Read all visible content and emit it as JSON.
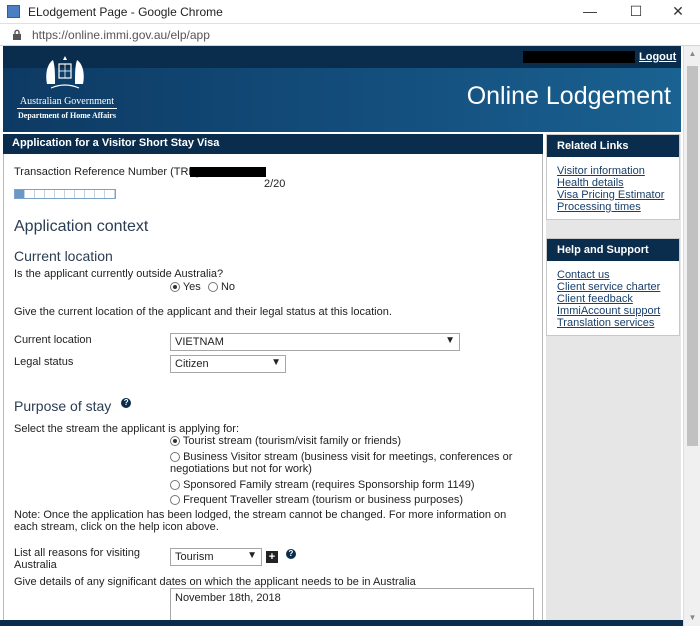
{
  "browser": {
    "window_title": "ELodgement Page - Google Chrome",
    "url": "https://online.immi.gov.au/elp/app",
    "minimize": "—",
    "maximize": "☐",
    "close": "✕"
  },
  "header": {
    "logout": "Logout",
    "gov_name": "Australian Government",
    "department": "Department of Home Affairs",
    "site_title": "Online Lodgement"
  },
  "main": {
    "app_title": "Application for a Visitor Short Stay Visa",
    "trn_label": "Transaction Reference Number (TRN):",
    "progress_label": "2/20",
    "progress": {
      "current": 2,
      "total": 20
    },
    "section_title": "Application context",
    "current_location": {
      "heading": "Current location",
      "question": "Is the applicant currently outside Australia?",
      "yes": "Yes",
      "no": "No",
      "selected": "Yes",
      "instruction": "Give the current location of the applicant and their legal status at this location.",
      "location_label": "Current location",
      "location_value": "VIETNAM",
      "status_label": "Legal status",
      "status_value": "Citizen"
    },
    "purpose": {
      "heading": "Purpose of stay",
      "select_label": "Select the stream the applicant is applying for:",
      "options": [
        "Tourist stream (tourism/visit family or friends)",
        "Business Visitor stream (business visit for meetings, conferences or negotiations but not for work)",
        "Sponsored Family stream (requires Sponsorship form 1149)",
        "Frequent Traveller stream (tourism or business purposes)"
      ],
      "selected_index": 0,
      "note": "Note: Once the application has been lodged, the stream cannot be changed. For more information on each stream, click on the help icon above.",
      "reasons_label": "List all reasons for visiting Australia",
      "reasons_value": "Tourism",
      "dates_label": "Give details of any significant dates on which the applicant needs to be in Australia",
      "dates_value": "November 18th, 2018"
    }
  },
  "sidebar": {
    "related": {
      "title": "Related Links",
      "links": [
        "Visitor information",
        "Health details",
        "Visa Pricing Estimator",
        "Processing times"
      ]
    },
    "help": {
      "title": "Help and Support",
      "links": [
        "Contact us",
        "Client service charter",
        "Client feedback",
        "ImmiAccount support",
        "Translation services"
      ]
    }
  }
}
